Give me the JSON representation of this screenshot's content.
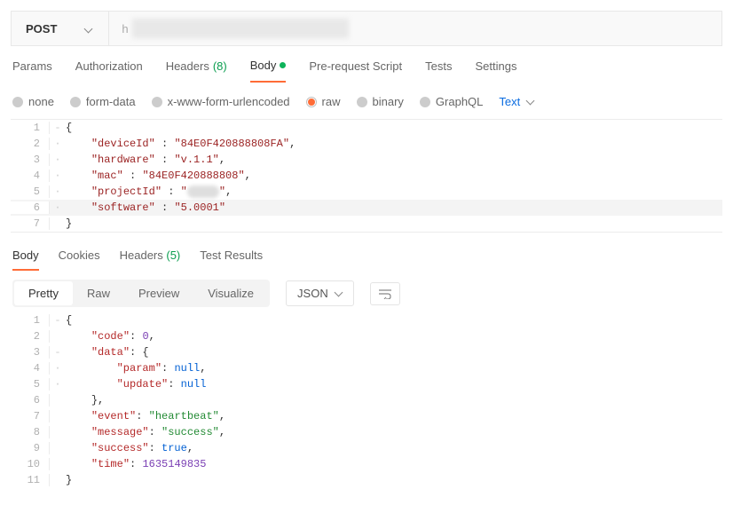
{
  "request": {
    "method": "POST",
    "url_start": "h"
  },
  "tabs": {
    "params": "Params",
    "authorization": "Authorization",
    "headers": "Headers",
    "headers_count": "(8)",
    "body": "Body",
    "prerequest": "Pre-request Script",
    "tests": "Tests",
    "settings": "Settings"
  },
  "body_types": {
    "none": "none",
    "formdata": "form-data",
    "xwww": "x-www-form-urlencoded",
    "raw": "raw",
    "binary": "binary",
    "graphql": "GraphQL",
    "text": "Text"
  },
  "req_lines": {
    "l1": "{",
    "l2_key": "\"deviceId\"",
    "l2_val": "\"84E0F420888808FA\"",
    "l3_key": "\"hardware\"",
    "l3_val": "\"v.1.1\"",
    "l4_key": "\"mac\"",
    "l4_val": "\"84E0F420888808\"",
    "l5_key": "\"projectId\"",
    "l5_val_a": "\"",
    "l5_val_b": "\"",
    "l6_key": "\"software\"",
    "l6_val": "\"5.0001\"",
    "l7": "}"
  },
  "line_numbers": {
    "n1": "1",
    "n2": "2",
    "n3": "3",
    "n4": "4",
    "n5": "5",
    "n6": "6",
    "n7": "7",
    "r1": "1",
    "r2": "2",
    "r3": "3",
    "r4": "4",
    "r5": "5",
    "r6": "6",
    "r7": "7",
    "r8": "8",
    "r9": "9",
    "r10": "10",
    "r11": "11"
  },
  "response_tabs": {
    "body": "Body",
    "cookies": "Cookies",
    "headers": "Headers",
    "headers_count": "(5)",
    "test_results": "Test Results"
  },
  "response_toolbar": {
    "pretty": "Pretty",
    "raw": "Raw",
    "preview": "Preview",
    "visualize": "Visualize",
    "json": "JSON"
  },
  "resp_lines": {
    "l1": "{",
    "l2_key": "\"code\"",
    "l2_val": "0",
    "l3_key": "\"data\"",
    "l4_key": "\"param\"",
    "l4_val": "null",
    "l5_key": "\"update\"",
    "l5_val": "null",
    "l7_key": "\"event\"",
    "l7_val": "\"heartbeat\"",
    "l8_key": "\"message\"",
    "l8_val": "\"success\"",
    "l9_key": "\"success\"",
    "l9_val": "true",
    "l10_key": "\"time\"",
    "l10_val": "1635149835",
    "l11": "}"
  }
}
